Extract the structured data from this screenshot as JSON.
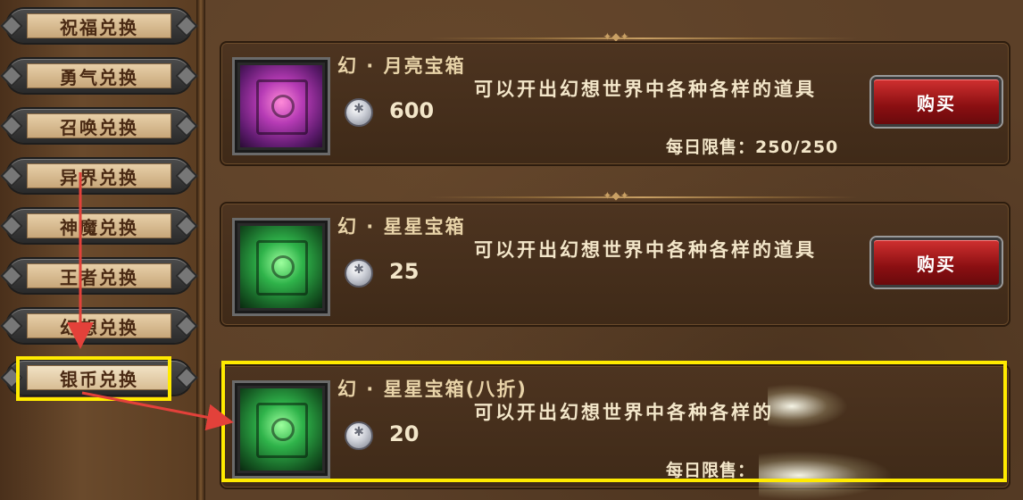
{
  "sidebar": {
    "tabs": [
      {
        "label": "祝福兑换"
      },
      {
        "label": "勇气兑换"
      },
      {
        "label": "召唤兑换"
      },
      {
        "label": "异界兑换"
      },
      {
        "label": "神魔兑换"
      },
      {
        "label": "王者兑换"
      },
      {
        "label": "幻想兑换"
      },
      {
        "label": "银币兑换",
        "selected": true
      }
    ]
  },
  "items": [
    {
      "name": "幻 · 月亮宝箱",
      "description": "可以开出幻想世界中各种各样的道具",
      "price": "600",
      "limit": "每日限售：250/250",
      "buy_label": "购买",
      "chest_color": "purple"
    },
    {
      "name": "幻 · 星星宝箱",
      "description": "可以开出幻想世界中各种各样的道具",
      "price": "25",
      "limit": "",
      "buy_label": "购买",
      "chest_color": "green"
    },
    {
      "name": "幻 · 星星宝箱(八折)",
      "description": "可以开出幻想世界中各种各样的",
      "price": "20",
      "limit": "每日限售：",
      "buy_label": "",
      "chest_color": "green"
    }
  ],
  "icons": {
    "currency": "silver-coin-icon",
    "chest": "treasure-chest-icon"
  },
  "colors": {
    "highlight": "#ffea00",
    "arrow": "#e3413a",
    "buy_button": "#b01c1f"
  }
}
